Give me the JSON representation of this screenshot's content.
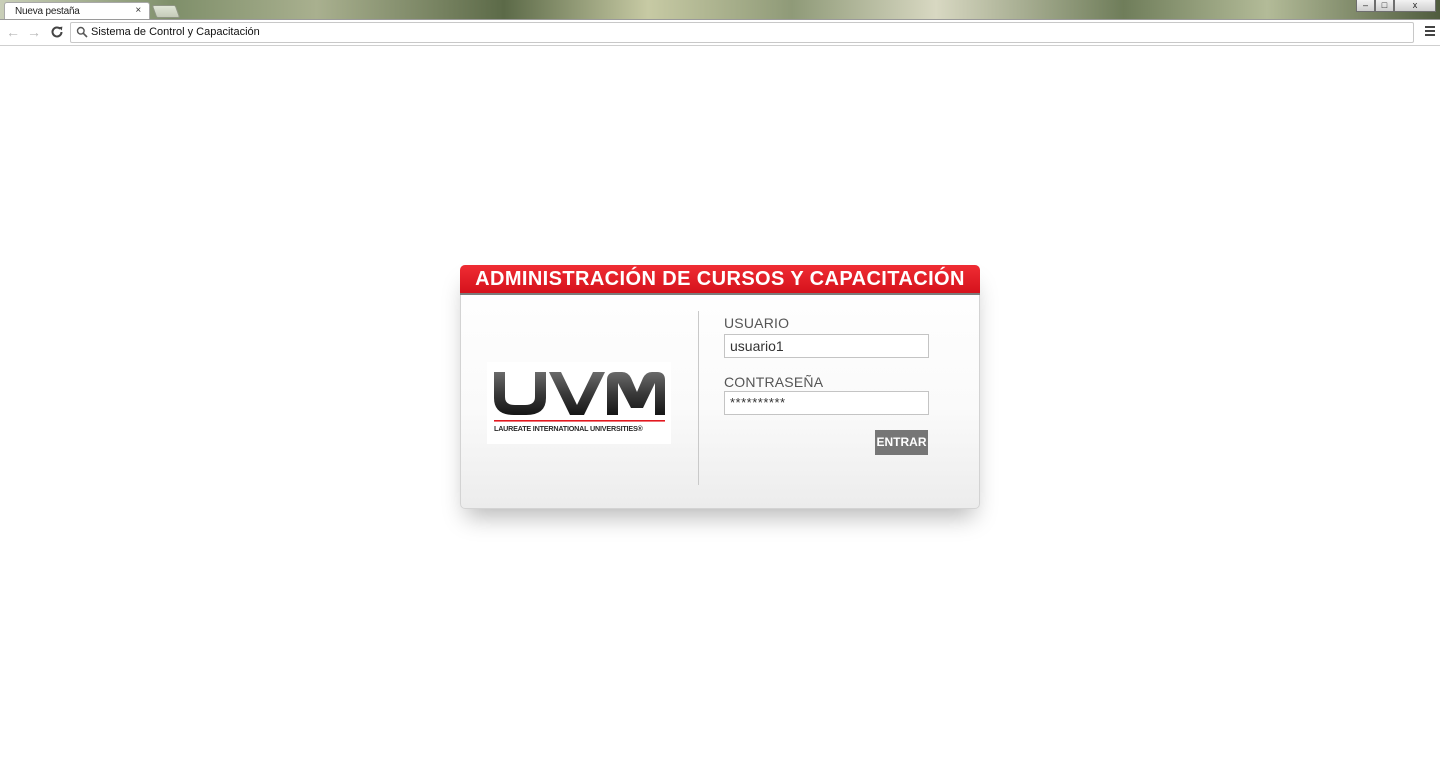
{
  "browser": {
    "tab_title": "Nueva pestaña",
    "tab_close": "×",
    "window_controls": {
      "minimize": "–",
      "maximize": "□",
      "close": "x"
    },
    "nav": {
      "back": "←",
      "forward": "→",
      "reload": "C"
    },
    "omnibox_text": "Sistema de Control y Capacitación",
    "icons": [
      "back-arrow-icon",
      "forward-arrow-icon",
      "reload-icon",
      "search-icon",
      "menu-icon"
    ]
  },
  "login": {
    "header_title": "ADMINISTRACIÓN DE CURSOS Y CAPACITACIÓN",
    "logo": {
      "wordmark": "UVM",
      "tagline": "LAUREATE INTERNATIONAL UNIVERSITIES®"
    },
    "user_label": "USUARIO",
    "user_value": "usuario1",
    "password_label": "CONTRASEÑA",
    "password_value": "**********",
    "submit_label": "ENTRAR"
  },
  "colors": {
    "header_red": "#e2181f",
    "button_gray": "#767676",
    "label_gray": "#555555"
  }
}
